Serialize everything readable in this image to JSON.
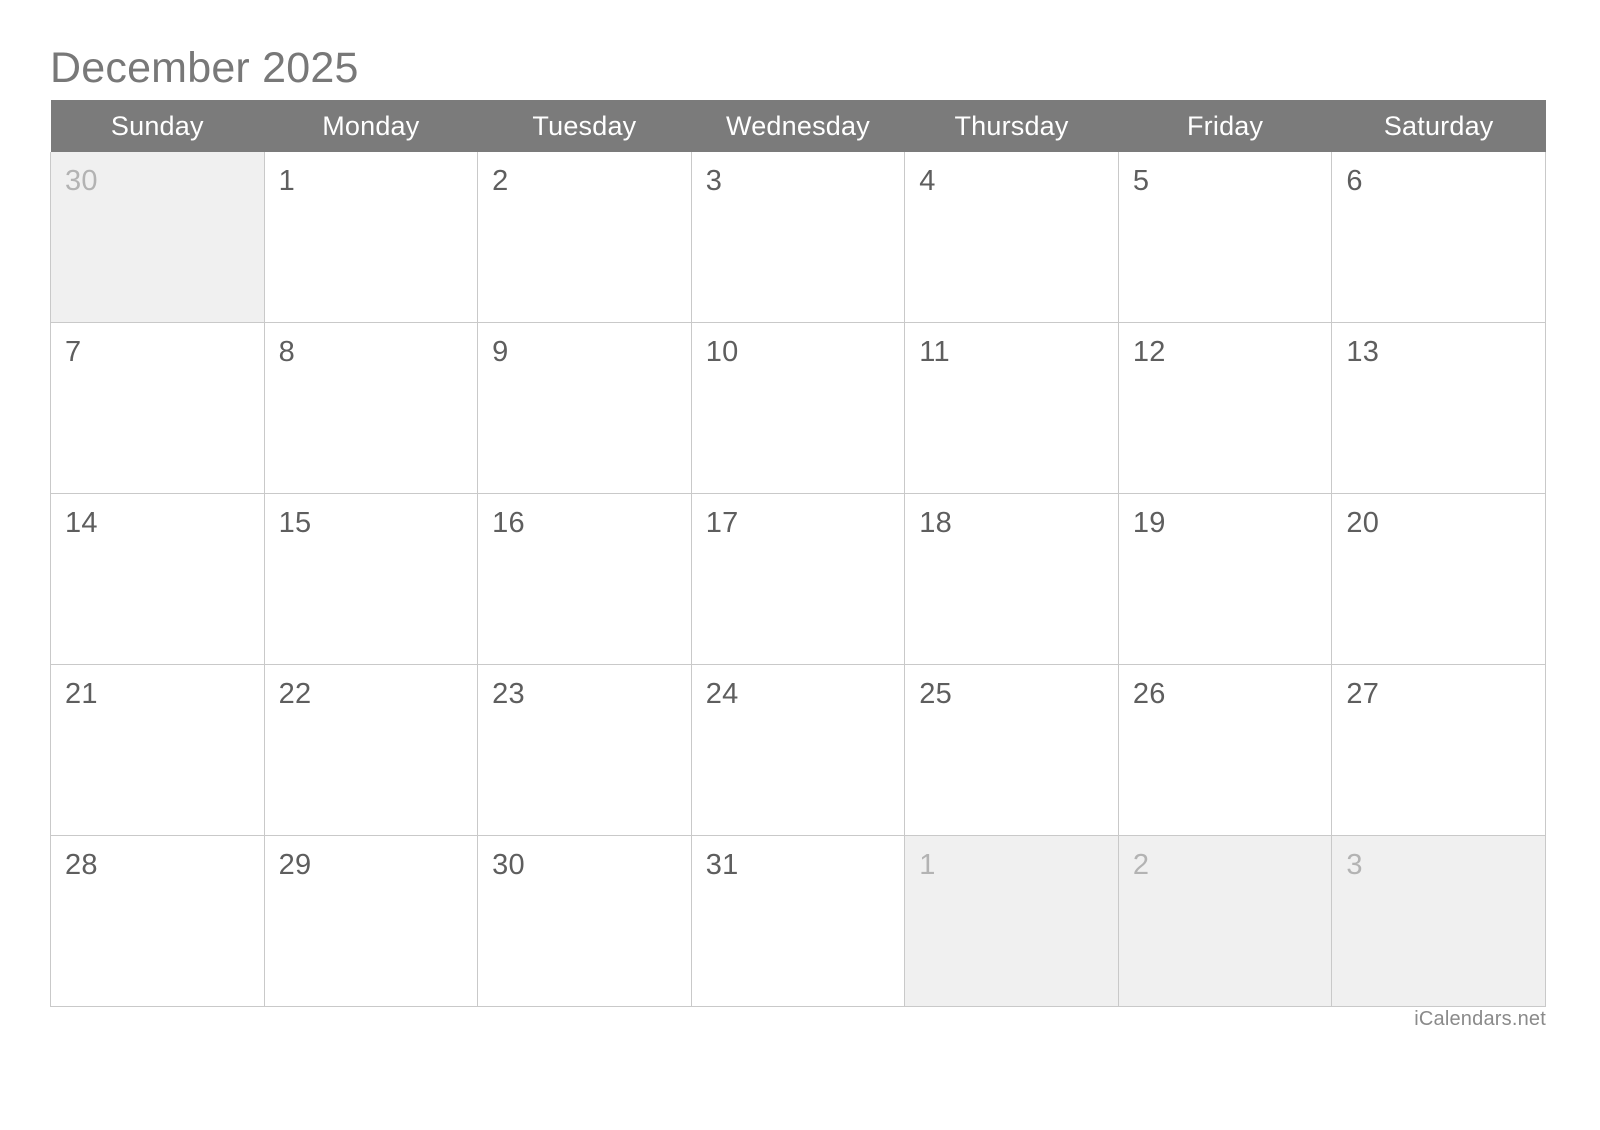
{
  "title": "December 2025",
  "month": "December",
  "year": "2025",
  "weekdays": [
    "Sunday",
    "Monday",
    "Tuesday",
    "Wednesday",
    "Thursday",
    "Friday",
    "Saturday"
  ],
  "weeks": [
    [
      {
        "num": "30",
        "adjacent": true
      },
      {
        "num": "1",
        "adjacent": false
      },
      {
        "num": "2",
        "adjacent": false
      },
      {
        "num": "3",
        "adjacent": false
      },
      {
        "num": "4",
        "adjacent": false
      },
      {
        "num": "5",
        "adjacent": false
      },
      {
        "num": "6",
        "adjacent": false
      }
    ],
    [
      {
        "num": "7",
        "adjacent": false
      },
      {
        "num": "8",
        "adjacent": false
      },
      {
        "num": "9",
        "adjacent": false
      },
      {
        "num": "10",
        "adjacent": false
      },
      {
        "num": "11",
        "adjacent": false
      },
      {
        "num": "12",
        "adjacent": false
      },
      {
        "num": "13",
        "adjacent": false
      }
    ],
    [
      {
        "num": "14",
        "adjacent": false
      },
      {
        "num": "15",
        "adjacent": false
      },
      {
        "num": "16",
        "adjacent": false
      },
      {
        "num": "17",
        "adjacent": false
      },
      {
        "num": "18",
        "adjacent": false
      },
      {
        "num": "19",
        "adjacent": false
      },
      {
        "num": "20",
        "adjacent": false
      }
    ],
    [
      {
        "num": "21",
        "adjacent": false
      },
      {
        "num": "22",
        "adjacent": false
      },
      {
        "num": "23",
        "adjacent": false
      },
      {
        "num": "24",
        "adjacent": false
      },
      {
        "num": "25",
        "adjacent": false
      },
      {
        "num": "26",
        "adjacent": false
      },
      {
        "num": "27",
        "adjacent": false
      }
    ],
    [
      {
        "num": "28",
        "adjacent": false
      },
      {
        "num": "29",
        "adjacent": false
      },
      {
        "num": "30",
        "adjacent": false
      },
      {
        "num": "31",
        "adjacent": false
      },
      {
        "num": "1",
        "adjacent": true
      },
      {
        "num": "2",
        "adjacent": true
      },
      {
        "num": "3",
        "adjacent": true
      }
    ]
  ],
  "watermark": "iCalendars.net",
  "colors": {
    "header_background": "#7b7b7b",
    "header_text": "#ffffff",
    "title_text": "#787878",
    "day_number": "#5e5e5e",
    "adjacent_day_number": "#b3b3b3",
    "adjacent_cell_background": "#f0f0f0",
    "grid_line": "#c9c9c9",
    "page_background": "#ffffff",
    "watermark_text": "#8a8a8a"
  }
}
